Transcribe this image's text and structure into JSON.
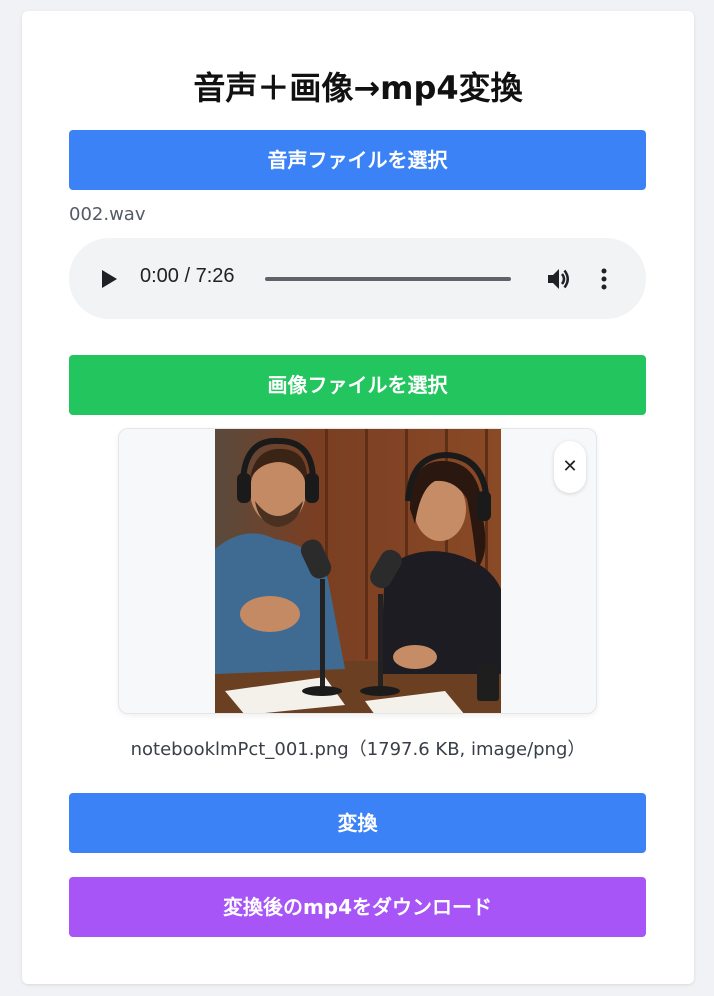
{
  "page": {
    "title": "音声＋画像→mp4変換"
  },
  "audio": {
    "select_label": "音声ファイルを選択",
    "filename": "002.wav",
    "player": {
      "time": "0:00 / 7:26",
      "progress": 0
    }
  },
  "image": {
    "select_label": "画像ファイルを選択",
    "close_label": "✕",
    "info": "notebooklmPct_001.png（1797.6 KB, image/png）"
  },
  "actions": {
    "convert_label": "変換",
    "download_label": "変換後のmp4をダウンロード"
  },
  "colors": {
    "audio_button": "#3b82f6",
    "image_button": "#22c55e",
    "convert_button": "#3b82f6",
    "download_button": "#a855f7"
  }
}
